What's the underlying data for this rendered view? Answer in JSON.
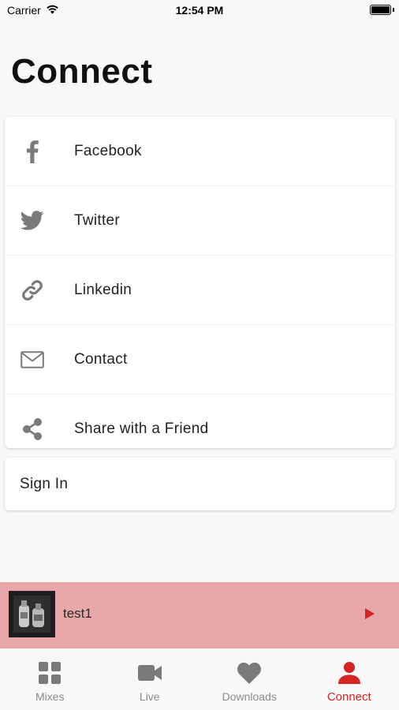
{
  "status_bar": {
    "carrier": "Carrier",
    "time": "12:54 PM"
  },
  "page": {
    "title": "Connect"
  },
  "menu": {
    "items": [
      {
        "label": "Facebook",
        "icon": "facebook-icon"
      },
      {
        "label": "Twitter",
        "icon": "twitter-icon"
      },
      {
        "label": "Linkedin",
        "icon": "link-icon"
      },
      {
        "label": "Contact",
        "icon": "envelope-icon"
      },
      {
        "label": "Share with a Friend",
        "icon": "share-icon"
      }
    ]
  },
  "signin": {
    "label": "Sign In"
  },
  "player": {
    "track_title": "test1",
    "accent_color": "#d42424",
    "background": "#e8a7a8"
  },
  "tabs": [
    {
      "label": "Mixes",
      "icon": "grid-icon",
      "active": false
    },
    {
      "label": "Live",
      "icon": "video-camera-icon",
      "active": false
    },
    {
      "label": "Downloads",
      "icon": "heart-icon",
      "active": false
    },
    {
      "label": "Connect",
      "icon": "user-icon",
      "active": true
    }
  ]
}
